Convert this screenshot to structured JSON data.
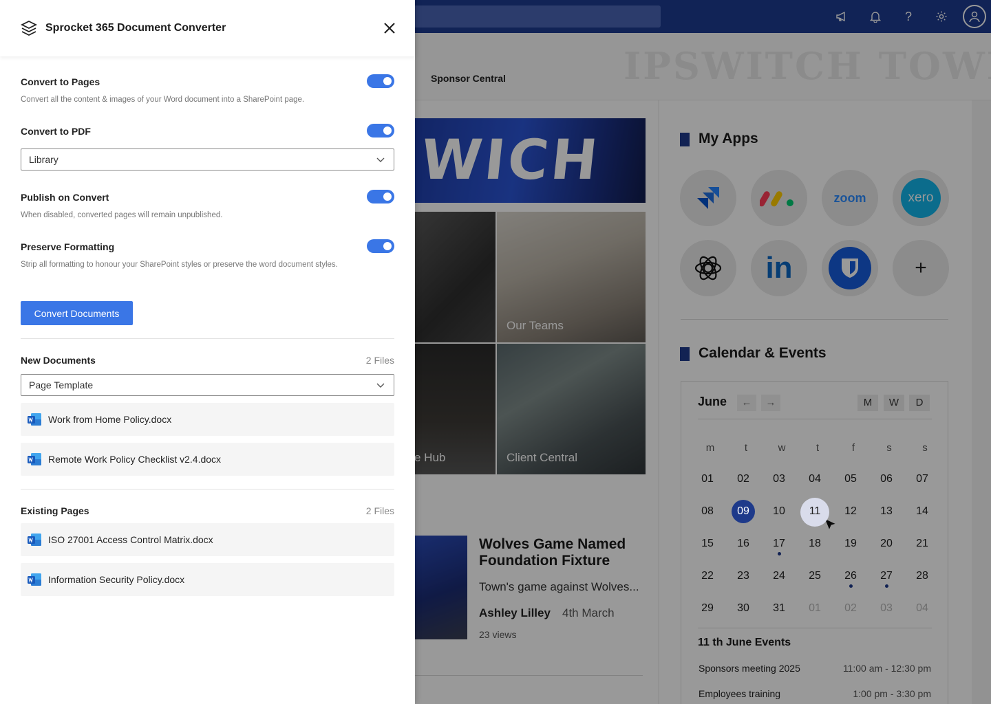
{
  "panel": {
    "title": "Sprocket 365 Document Converter",
    "options": [
      {
        "label": "Convert to Pages",
        "description": "Convert all the content & images of your Word document into a SharePoint page.",
        "enabled": true
      },
      {
        "label": "Convert to PDF",
        "description": "",
        "enabled": true
      },
      {
        "label": "Publish on Convert",
        "description": "When disabled, converted pages will remain unpublished.",
        "enabled": true
      },
      {
        "label": "Preserve Formatting",
        "description": "Strip all formatting to honour your SharePoint styles or preserve the word document styles.",
        "enabled": true
      }
    ],
    "pdf_destination": {
      "selected": "Library"
    },
    "convert_button": "Convert Documents",
    "new_documents": {
      "heading": "New Documents",
      "count": "2 Files",
      "template": {
        "selected": "Page Template"
      },
      "files": [
        "Work from Home Policy.docx",
        "Remote Work Policy Checklist v2.4.docx"
      ]
    },
    "existing_pages": {
      "heading": "Existing Pages",
      "count": "2 Files",
      "files": [
        "ISO 27001 Access Control Matrix.docx",
        "Information Security Policy.docx"
      ]
    },
    "accent_color": "#3a76e6"
  },
  "background": {
    "suite_icons": [
      "megaphone-icon",
      "bell-icon",
      "help-icon",
      "gear-icon",
      "user-icon"
    ],
    "watermark": "IPSWITCH TOWN",
    "nav_link": "Sponsor Central",
    "hero_text": "WICH",
    "tiles": [
      "Our Teams",
      "e Hub",
      "Client Central"
    ],
    "news": {
      "title": "Wolves Game Named Foundation Fixture",
      "excerpt": "Town's game against Wolves...",
      "author": "Ashley Lilley",
      "date": "4th March",
      "views": "23 views"
    },
    "my_apps": {
      "title": "My Apps",
      "apps": [
        "jira-icon",
        "monday-icon",
        "zoom",
        "xero",
        "openai-icon",
        "linkedin-icon",
        "bitwarden-icon",
        "add-icon"
      ],
      "zoom_label": "zoom",
      "xero_label": "xero",
      "linkedin_label": "in",
      "add_label": "+"
    },
    "calendar": {
      "title": "Calendar & Events",
      "month": "June",
      "prev": "←",
      "next": "→",
      "views": [
        "M",
        "W",
        "D"
      ],
      "weekdays": [
        "m",
        "t",
        "w",
        "t",
        "f",
        "s",
        "s"
      ],
      "weeks": [
        [
          "01",
          "02",
          "03",
          "04",
          "05",
          "06",
          "07"
        ],
        [
          "08",
          "09",
          "10",
          "11",
          "12",
          "13",
          "14"
        ],
        [
          "15",
          "16",
          "17",
          "18",
          "19",
          "20",
          "21"
        ],
        [
          "22",
          "23",
          "24",
          "25",
          "26",
          "27",
          "28"
        ],
        [
          "29",
          "30",
          "31",
          "01",
          "02",
          "03",
          "04"
        ]
      ],
      "today": "09",
      "hovered": "11",
      "event_days": [
        "11",
        "17",
        "26",
        "27"
      ],
      "events_title": "11 th June Events",
      "events": [
        {
          "name": "Sponsors meeting 2025",
          "time": "11:00 am - 12:30 pm"
        },
        {
          "name": "Employees training",
          "time": "1:00 pm - 3:30 pm"
        }
      ]
    }
  }
}
